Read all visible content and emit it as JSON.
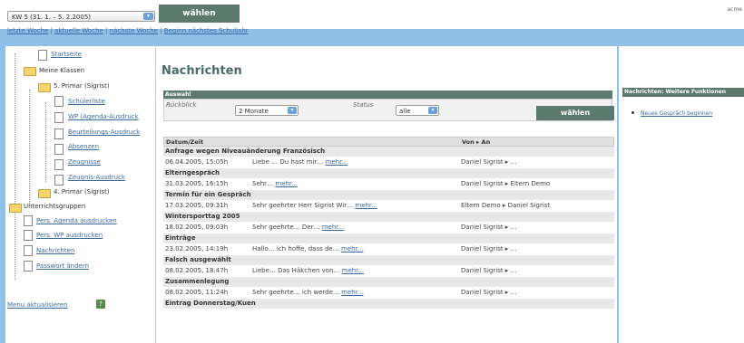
{
  "topbar": {
    "week_select": "KW 5 (31. 1. – 5. 2.2005)",
    "waehlen_button": "wählen",
    "links": [
      "letzte Woche",
      "aktuelle Woche",
      "nächste Woche",
      "Beginn nächstes Schuljahr"
    ],
    "separator": "|",
    "topright": "acme"
  },
  "sidebar": {
    "items": [
      {
        "label": "Startseite"
      },
      {
        "label": "Meine Klassen"
      },
      {
        "label": "5. Primar (Sigrist)"
      },
      {
        "label": "Schülerliste"
      },
      {
        "label": "WP (Agenda-Ausdruck"
      },
      {
        "label": "Beurteilungs-Ausdruck"
      },
      {
        "label": "Absenzen"
      },
      {
        "label": "Zeugnisse"
      },
      {
        "label": "Zeugnis-Ausdruck"
      },
      {
        "label": "4. Primar (Sigrist)"
      },
      {
        "label": "Unterrichtsgruppen"
      },
      {
        "label": "Pers. Agenda ausdrucken"
      },
      {
        "label": "Pers. WP ausdrucken"
      },
      {
        "label": "Nachrichten"
      },
      {
        "label": "Passwort ändern"
      }
    ],
    "menu_refresh": "Menu aktualisieren",
    "help_icon": "?"
  },
  "main": {
    "title": "Nachrichten",
    "auswahl": {
      "header": "Auswahl",
      "rueckblick_label": "Rückblick",
      "rueckblick_value": "2 Monate",
      "status_label": "Status",
      "status_value": "alle",
      "waehlen_button": "wählen"
    },
    "table": {
      "col_date": "Datum/Zeit",
      "col_fromto": "Von ▸ An",
      "groups": [
        {
          "subject": "Anfrage wegen Niveauänderung Französisch",
          "date": "06.04.2005, 15:05h",
          "text": "Liebe … Du hast mir…",
          "more": "mehr...",
          "fromto": "Daniel Sigrist ▸ …"
        },
        {
          "subject": "Elterngespräch",
          "date": "31.03.2005, 16:15h",
          "text": "Sehr…",
          "more": "mehr...",
          "fromto": "Daniel Sigrist ▸ Eltern Demo"
        },
        {
          "subject": "Termin für ein Gespräch",
          "date": "17.03.2005, 09:31h",
          "text": "Sehr geehrter Herr Sigrist Wir…",
          "more": "mehr...",
          "fromto": "Eltern Demo ▸ Daniel Sigrist"
        },
        {
          "subject": "Wintersporttag 2005",
          "date": "18.02.2005, 09:03h",
          "text": "Sehr geehrte… Der…",
          "more": "mehr...",
          "fromto": "Daniel Sigrist ▸ …"
        },
        {
          "subject": "Einträge",
          "date": "23.02.2005, 14:19h",
          "text": "Hallo… ich hoffe, dass de…",
          "more": "mehr...",
          "fromto": "Daniel Sigrist ▸ …"
        },
        {
          "subject": "Falsch ausgewählt",
          "date": "08.02.2005, 18:47h",
          "text": "Liebe… Das Häkchen von…",
          "more": "mehr...",
          "fromto": "Daniel Sigrist ▸ …"
        },
        {
          "subject": "Zusammenlegung",
          "date": "08.02.2005, 11:24h",
          "text": "Sehr geehrte… ich werde…",
          "more": "mehr...",
          "fromto": "Daniel Sigrist ▸ …"
        },
        {
          "subject": "Eintrag Donnerstag/Kuen",
          "date": "",
          "text": "",
          "more": "",
          "fromto": ""
        }
      ]
    }
  },
  "right_panel": {
    "header": "Nachrichten: Weitere Funktionen",
    "link": "Neues Gespräch beginnen"
  },
  "colors": {
    "accent_green": "#5b7a6d",
    "background_blue": "#8fc0e8",
    "link_blue": "#3a6aa0"
  }
}
